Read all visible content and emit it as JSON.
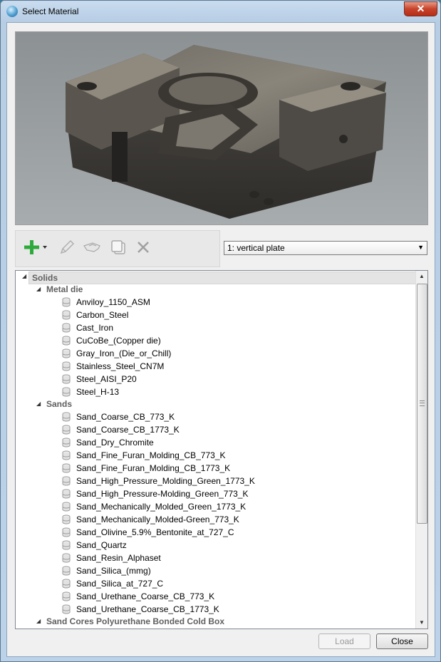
{
  "window": {
    "title": "Select Material",
    "close_glyph": "✕"
  },
  "toolbar": {
    "buttons": [
      {
        "icon": "plus-dropdown-icon",
        "enabled": true
      },
      {
        "icon": "pencil-icon",
        "enabled": false
      },
      {
        "icon": "hat-icon",
        "enabled": false
      },
      {
        "icon": "copy-icon",
        "enabled": false
      },
      {
        "icon": "delete-x-icon",
        "enabled": false
      }
    ]
  },
  "combo": {
    "selected": "1: vertical plate"
  },
  "tree": {
    "root": {
      "label": "Solids"
    },
    "groups": [
      {
        "label": "Metal die",
        "items": [
          "Anviloy_1150_ASM",
          "Carbon_Steel",
          "Cast_Iron",
          "CuCoBe_(Copper die)",
          "Gray_Iron_(Die_or_Chill)",
          "Stainless_Steel_CN7M",
          "Steel_AISI_P20",
          "Steel_H-13"
        ]
      },
      {
        "label": "Sands",
        "items": [
          "Sand_Coarse_CB_773_K",
          "Sand_Coarse_CB_1773_K",
          "Sand_Dry_Chromite",
          "Sand_Fine_Furan_Molding_CB_773_K",
          "Sand_Fine_Furan_Molding_CB_1773_K",
          "Sand_High_Pressure_Molding_Green_1773_K",
          "Sand_High_Pressure-Molding_Green_773_K",
          "Sand_Mechanically_Molded_Green_1773_K",
          "Sand_Mechanically_Molded-Green_773_K",
          "Sand_Olivine_5.9%_Bentonite_at_727_C",
          "Sand_Quartz",
          "Sand_Resin_Alphaset",
          "Sand_Silica_(mmg)",
          "Sand_Silica_at_727_C",
          "Sand_Urethane_Coarse_CB_773_K",
          "Sand_Urethane_Coarse_CB_1773_K"
        ]
      },
      {
        "label": "Sand Cores Polyurethane Bonded Cold Box",
        "items": []
      }
    ]
  },
  "buttons": {
    "load": "Load",
    "close": "Close"
  },
  "colors": {
    "plus": "#2eaa3c",
    "disabled_icon": "#a8a8a8",
    "title_close": "#c8432b"
  }
}
